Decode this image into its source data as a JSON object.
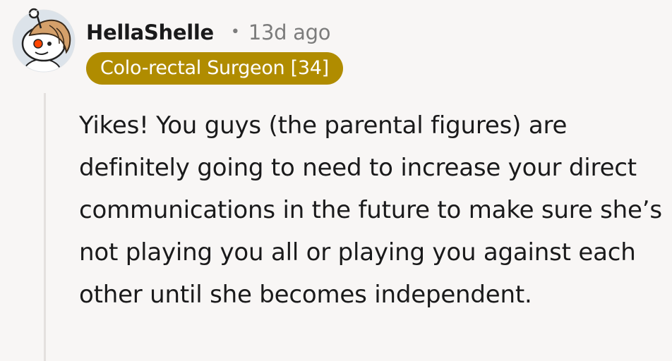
{
  "comment": {
    "author": "HellaShelle",
    "separator": "•",
    "age": "13d ago",
    "flair": "Colo-rectal Surgeon [34]",
    "body": "Yikes! You guys (the parental figures) are definitely going to need to increase your direct communications in the future to make sure she’s not playing you all or playing you against each other until she becomes independent."
  },
  "colors": {
    "background": "#f8f6f5",
    "flair_background": "#b08c00",
    "flair_text": "#ffffff",
    "muted_text": "#7c7c7c",
    "thread_line": "#e4e0de"
  },
  "icons": {
    "avatar": "snoo-avatar-icon"
  }
}
